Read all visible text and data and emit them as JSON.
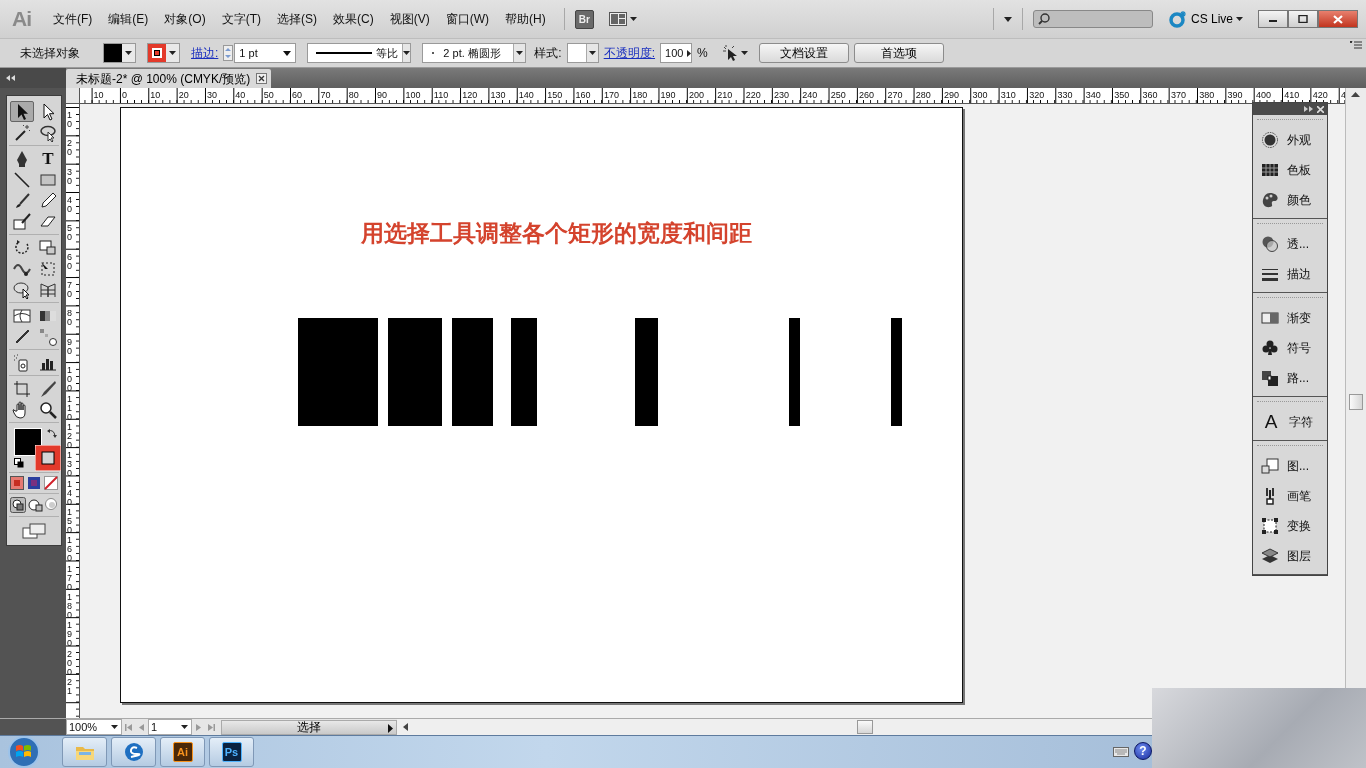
{
  "app": {
    "logo": "Ai",
    "bridge": "Br",
    "cs_live": "CS Live"
  },
  "menu": [
    "文件(F)",
    "编辑(E)",
    "对象(O)",
    "文字(T)",
    "选择(S)",
    "效果(C)",
    "视图(V)",
    "窗口(W)",
    "帮助(H)"
  ],
  "control_bar": {
    "selection": "未选择对象",
    "stroke_label": "描边:",
    "stroke_weight": "1 pt",
    "stroke_profile": "等比",
    "brush": "2 pt. 椭圆形",
    "style_label": "样式:",
    "opacity_label": "不透明度:",
    "opacity": "100",
    "percent": "%",
    "buttons": [
      "文档设置",
      "首选项"
    ]
  },
  "document_tab": {
    "title": "未标题-2* @ 100% (CMYK/预览)",
    "selected": true
  },
  "rulers": {
    "horizontal": [
      "10",
      "0",
      "10",
      "20",
      "30",
      "40",
      "50",
      "60",
      "70",
      "80",
      "90",
      "100",
      "110",
      "120",
      "130",
      "140",
      "150",
      "160",
      "170",
      "180",
      "190",
      "200",
      "210",
      "220",
      "230",
      "240",
      "250",
      "260",
      "270",
      "280",
      "290",
      "300",
      "310",
      "320",
      "330",
      "340",
      "350",
      "360",
      "370",
      "380",
      "390",
      "400",
      "410",
      "420",
      "4"
    ],
    "vertical": [
      "10",
      "20",
      "30",
      "40",
      "50",
      "60",
      "70",
      "80",
      "90",
      "100",
      "110",
      "120",
      "130",
      "140",
      "150",
      "160",
      "170",
      "180",
      "190",
      "200",
      "21"
    ]
  },
  "tool_groups": [
    [
      {
        "kind": "selection",
        "selected": true
      },
      {
        "kind": "direct-selection",
        "selected": false
      },
      {
        "kind": "magic-wand",
        "selected": false
      },
      {
        "kind": "lasso",
        "selected": false
      }
    ],
    [
      {
        "kind": "pen",
        "selected": false
      },
      {
        "kind": "type",
        "glyph": "T",
        "selected": false
      },
      {
        "kind": "line",
        "selected": false
      },
      {
        "kind": "rectangle",
        "selected": false
      },
      {
        "kind": "paintbrush",
        "selected": false
      },
      {
        "kind": "pencil",
        "selected": false
      },
      {
        "kind": "blob-brush",
        "selected": false
      },
      {
        "kind": "eraser",
        "selected": false
      }
    ],
    [
      {
        "kind": "rotate",
        "selected": false
      },
      {
        "kind": "scale",
        "selected": false
      },
      {
        "kind": "warp",
        "selected": false
      },
      {
        "kind": "free-transform",
        "selected": false
      },
      {
        "kind": "shape-builder",
        "selected": false
      },
      {
        "kind": "perspective",
        "selected": false
      }
    ],
    [
      {
        "kind": "mesh",
        "selected": false
      },
      {
        "kind": "gradient",
        "selected": false
      },
      {
        "kind": "eyedropper",
        "selected": false
      },
      {
        "kind": "blend",
        "selected": false
      }
    ],
    [
      {
        "kind": "symbol-sprayer",
        "selected": false
      },
      {
        "kind": "graph",
        "selected": false
      }
    ],
    [
      {
        "kind": "artboard",
        "selected": false
      },
      {
        "kind": "slice",
        "selected": false
      },
      {
        "kind": "hand",
        "selected": false
      },
      {
        "kind": "zoom",
        "selected": false
      }
    ]
  ],
  "artboard": {
    "caption": "用选择工具调整各个矩形的宽度和间距"
  },
  "panel": {
    "groups": [
      [
        {
          "kind": "appearance",
          "label": "外观"
        },
        {
          "kind": "swatches",
          "label": "色板"
        },
        {
          "kind": "color",
          "label": "颜色"
        }
      ],
      [
        {
          "kind": "transparency",
          "label": "透..."
        },
        {
          "kind": "stroke",
          "label": "描边"
        }
      ],
      [
        {
          "kind": "gradient",
          "label": "渐变"
        },
        {
          "kind": "symbols",
          "label": "符号"
        },
        {
          "kind": "pathfinder",
          "label": "路..."
        }
      ],
      [
        {
          "kind": "character",
          "glyph": "A",
          "label": "字符"
        }
      ],
      [
        {
          "kind": "graphic-styles",
          "label": "图..."
        },
        {
          "kind": "brushes",
          "label": "画笔"
        },
        {
          "kind": "transform",
          "label": "变换"
        },
        {
          "kind": "layers",
          "label": "图层"
        }
      ]
    ]
  },
  "status_bar": {
    "zoom": "100%",
    "page": "1",
    "status": "选择"
  },
  "taskbar": {
    "apps": [
      {
        "kind": "explorer"
      },
      {
        "kind": "sogou"
      },
      {
        "kind": "illustrator",
        "label": "Ai"
      },
      {
        "kind": "photoshop",
        "label": "Ps"
      }
    ],
    "help": "?"
  }
}
